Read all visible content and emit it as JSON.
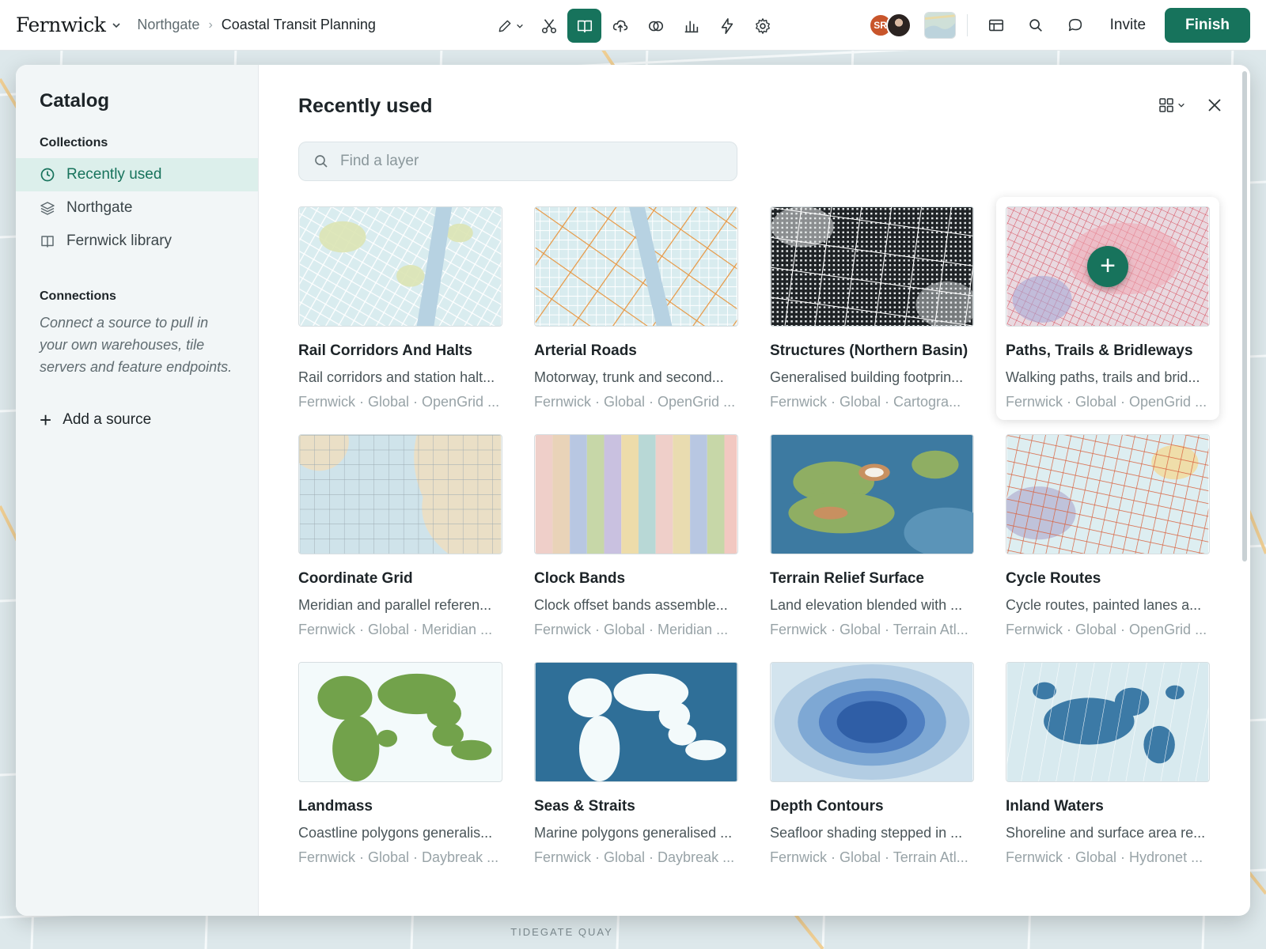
{
  "app": {
    "brand": "Fernwick",
    "breadcrumb_parent": "Northgate",
    "breadcrumb_current": "Coastal Transit Planning"
  },
  "toolbar": {
    "tools": [
      "pencil-icon",
      "scissors-icon",
      "book-icon",
      "upload-cloud-icon",
      "overlap-icon",
      "bar-chart-icon",
      "lightning-icon",
      "gear-icon"
    ],
    "active_tool": "book-icon",
    "avatar_initials": "SR",
    "invite_label": "Invite",
    "finish_label": "Finish"
  },
  "map": {
    "label": "TIDEGATE QUAY"
  },
  "catalog": {
    "title": "Catalog",
    "collections_heading": "Collections",
    "collections": [
      {
        "label": "Recently used",
        "icon": "clock-icon",
        "active": true
      },
      {
        "label": "Northgate",
        "icon": "layers-icon",
        "active": false
      },
      {
        "label": "Fernwick library",
        "icon": "book-icon",
        "active": false
      }
    ],
    "connections_heading": "Connections",
    "connections_desc": "Connect a source to pull in your own warehouses, tile servers and feature endpoints.",
    "add_source_label": "Add a source"
  },
  "main": {
    "title": "Recently used",
    "search_placeholder": "Find a layer",
    "cards": [
      {
        "title": "Rail Corridors And Halts",
        "desc": "Rail corridors and station halt...",
        "meta": "Fernwick · Global · OpenGrid ..."
      },
      {
        "title": "Arterial Roads",
        "desc": "Motorway, trunk and second...",
        "meta": "Fernwick · Global · OpenGrid ..."
      },
      {
        "title": "Structures (Northern Basin)",
        "desc": "Generalised building footprin...",
        "meta": "Fernwick · Global · Cartogra..."
      },
      {
        "title": "Paths, Trails & Bridleways",
        "desc": "Walking paths, trails and brid...",
        "meta": "Fernwick · Global · OpenGrid ..."
      },
      {
        "title": "Coordinate Grid",
        "desc": "Meridian and parallel referen...",
        "meta": "Fernwick · Global · Meridian ..."
      },
      {
        "title": "Clock Bands",
        "desc": "Clock offset bands assemble...",
        "meta": "Fernwick · Global · Meridian ..."
      },
      {
        "title": "Terrain Relief Surface",
        "desc": "Land elevation blended with ...",
        "meta": "Fernwick · Global · Terrain Atl..."
      },
      {
        "title": "Cycle Routes",
        "desc": "Cycle routes, painted lanes a...",
        "meta": "Fernwick · Global · OpenGrid ..."
      },
      {
        "title": "Landmass",
        "desc": "Coastline polygons generalis...",
        "meta": "Fernwick · Global · Daybreak ..."
      },
      {
        "title": "Seas & Straits",
        "desc": "Marine polygons generalised ...",
        "meta": "Fernwick · Global · Daybreak ..."
      },
      {
        "title": "Depth Contours",
        "desc": "Seafloor shading stepped in ...",
        "meta": "Fernwick · Global · Terrain Atl..."
      },
      {
        "title": "Inland Waters",
        "desc": "Shoreline and surface area re...",
        "meta": "Fernwick · Global · Hydronet ..."
      }
    ]
  },
  "colors": {
    "accent": "#17735c",
    "sidebar_bg": "#f2f6f7",
    "active_item_bg": "#dcefeb"
  }
}
